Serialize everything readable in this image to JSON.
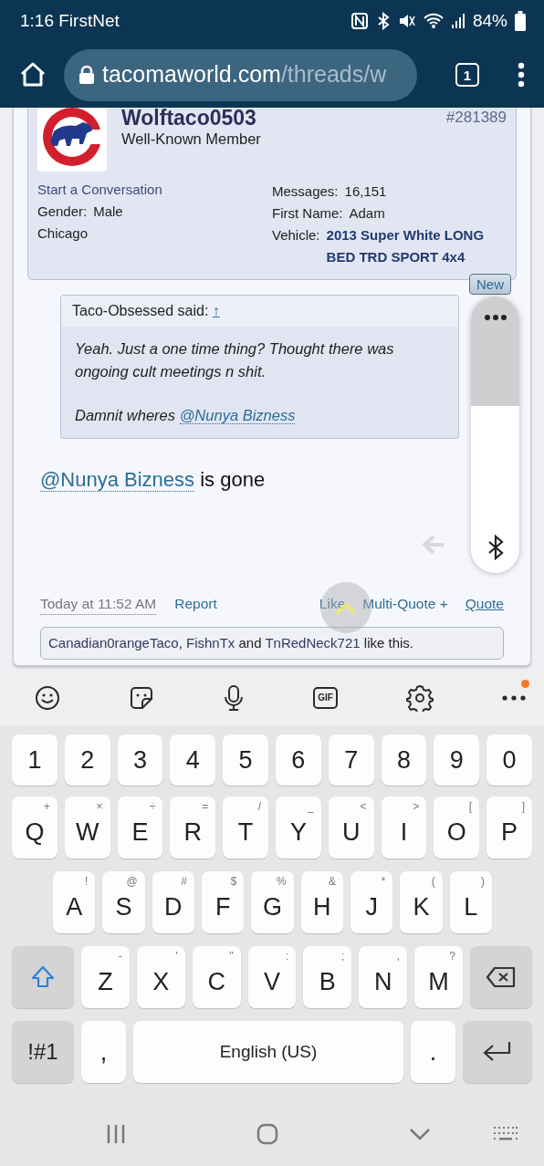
{
  "status_bar": {
    "time": "1:16",
    "carrier": "FirstNet",
    "battery": "84%"
  },
  "browser": {
    "url_host": "tacomaworld.com",
    "url_path": "/threads/w",
    "tab_count": "1"
  },
  "post": {
    "username": "Wolftaco0503",
    "user_title": "Well-Known Member",
    "post_number": "#281389",
    "start_conversation": "Start a Conversation",
    "left_fields": [
      {
        "label": "Gender:",
        "value": "Male"
      },
      {
        "value": "Chicago"
      }
    ],
    "right_fields": [
      {
        "label": "Messages:",
        "value": "16,151",
        "kind": "plain"
      },
      {
        "label": "First Name:",
        "value": "Adam",
        "kind": "plain"
      },
      {
        "label": "Vehicle:",
        "value": "2013 Super White LONG BED TRD SPORT 4x4",
        "kind": "bold"
      }
    ],
    "new_badge": "New",
    "quote": {
      "author": "Taco-Obsessed said:",
      "jump": "↑",
      "paragraphs": [
        {
          "text": "Yeah. Just a one time thing? Thought there was ongoing cult meetings n shit."
        },
        {
          "text": "Damnit wheres ",
          "mention": "@Nunya Bizness"
        }
      ]
    },
    "message": {
      "mention": "@Nunya Bizness",
      "text": "is gone"
    },
    "date": "Today at 11:52 AM",
    "actions_left": [
      "Report"
    ],
    "actions_right": [
      {
        "label": "Like",
        "kind": "plain"
      },
      {
        "label": "Multi-Quote +",
        "kind": "plain"
      },
      {
        "label": "Quote",
        "kind": "underlined"
      }
    ],
    "likes": [
      {
        "text": "Canadian0rangeTaco",
        "kind": "user"
      },
      {
        "text": ", ",
        "kind": "plain"
      },
      {
        "text": "FishnTx",
        "kind": "user"
      },
      {
        "text": " and ",
        "kind": "plain"
      },
      {
        "text": "TnRedNeck721",
        "kind": "user"
      },
      {
        "text": " like this.",
        "kind": "plain"
      }
    ]
  },
  "keyboard": {
    "toolbar": [
      {
        "kind": "emoji"
      },
      {
        "kind": "sticker"
      },
      {
        "kind": "mic"
      },
      {
        "kind": "gif",
        "label": "GIF"
      },
      {
        "kind": "settings"
      },
      {
        "kind": "more",
        "notification": true
      }
    ],
    "number_row": {
      "keys": [
        {
          "kind": "char",
          "label": "1"
        },
        {
          "kind": "char",
          "label": "2"
        },
        {
          "kind": "char",
          "label": "3"
        },
        {
          "kind": "char",
          "label": "4"
        },
        {
          "kind": "char",
          "label": "5"
        },
        {
          "kind": "char",
          "label": "6"
        },
        {
          "kind": "char",
          "label": "7"
        },
        {
          "kind": "char",
          "label": "8"
        },
        {
          "kind": "char",
          "label": "9"
        },
        {
          "kind": "char",
          "label": "0"
        }
      ]
    },
    "top_row": {
      "keys": [
        {
          "kind": "char",
          "label": "Q",
          "hint": "+"
        },
        {
          "kind": "char",
          "label": "W",
          "hint": "×"
        },
        {
          "kind": "char",
          "label": "E",
          "hint": "÷"
        },
        {
          "kind": "char",
          "label": "R",
          "hint": "="
        },
        {
          "kind": "char",
          "label": "T",
          "hint": "/"
        },
        {
          "kind": "char",
          "label": "Y",
          "hint": "_"
        },
        {
          "kind": "char",
          "label": "U",
          "hint": "<"
        },
        {
          "kind": "char",
          "label": "I",
          "hint": ">"
        },
        {
          "kind": "char",
          "label": "O",
          "hint": "["
        },
        {
          "kind": "char",
          "label": "P",
          "hint": "]"
        }
      ]
    },
    "home_row": {
      "keys": [
        {
          "kind": "char",
          "label": "A",
          "hint": "!"
        },
        {
          "kind": "char",
          "label": "S",
          "hint": "@"
        },
        {
          "kind": "char",
          "label": "D",
          "hint": "#"
        },
        {
          "kind": "char",
          "label": "F",
          "hint": "$"
        },
        {
          "kind": "char",
          "label": "G",
          "hint": "%"
        },
        {
          "kind": "char",
          "label": "H",
          "hint": "&"
        },
        {
          "kind": "char",
          "label": "J",
          "hint": "*"
        },
        {
          "kind": "char",
          "label": "K",
          "hint": "("
        },
        {
          "kind": "char",
          "label": "L",
          "hint": ")"
        }
      ]
    },
    "shift_row": {
      "keys": [
        {
          "kind": "shift",
          "on": true
        },
        {
          "kind": "char",
          "label": "Z",
          "hint": "-"
        },
        {
          "kind": "char",
          "label": "X",
          "hint": "'"
        },
        {
          "kind": "char",
          "label": "C",
          "hint": "\""
        },
        {
          "kind": "char",
          "label": "V",
          "hint": ":"
        },
        {
          "kind": "char",
          "label": "B",
          "hint": ";"
        },
        {
          "kind": "char",
          "label": "N",
          "hint": ","
        },
        {
          "kind": "char",
          "label": "M",
          "hint": "?"
        },
        {
          "kind": "backspace"
        }
      ]
    },
    "space_row": {
      "keys": [
        {
          "kind": "symbols",
          "label": "!#1"
        },
        {
          "kind": "punct",
          "label": ","
        },
        {
          "kind": "space",
          "label": "English (US)"
        },
        {
          "kind": "punct",
          "label": "."
        },
        {
          "kind": "enter"
        }
      ]
    }
  },
  "nav_bar": [
    {
      "kind": "recents"
    },
    {
      "kind": "home"
    },
    {
      "kind": "back"
    },
    {
      "kind": "keyboard"
    }
  ]
}
